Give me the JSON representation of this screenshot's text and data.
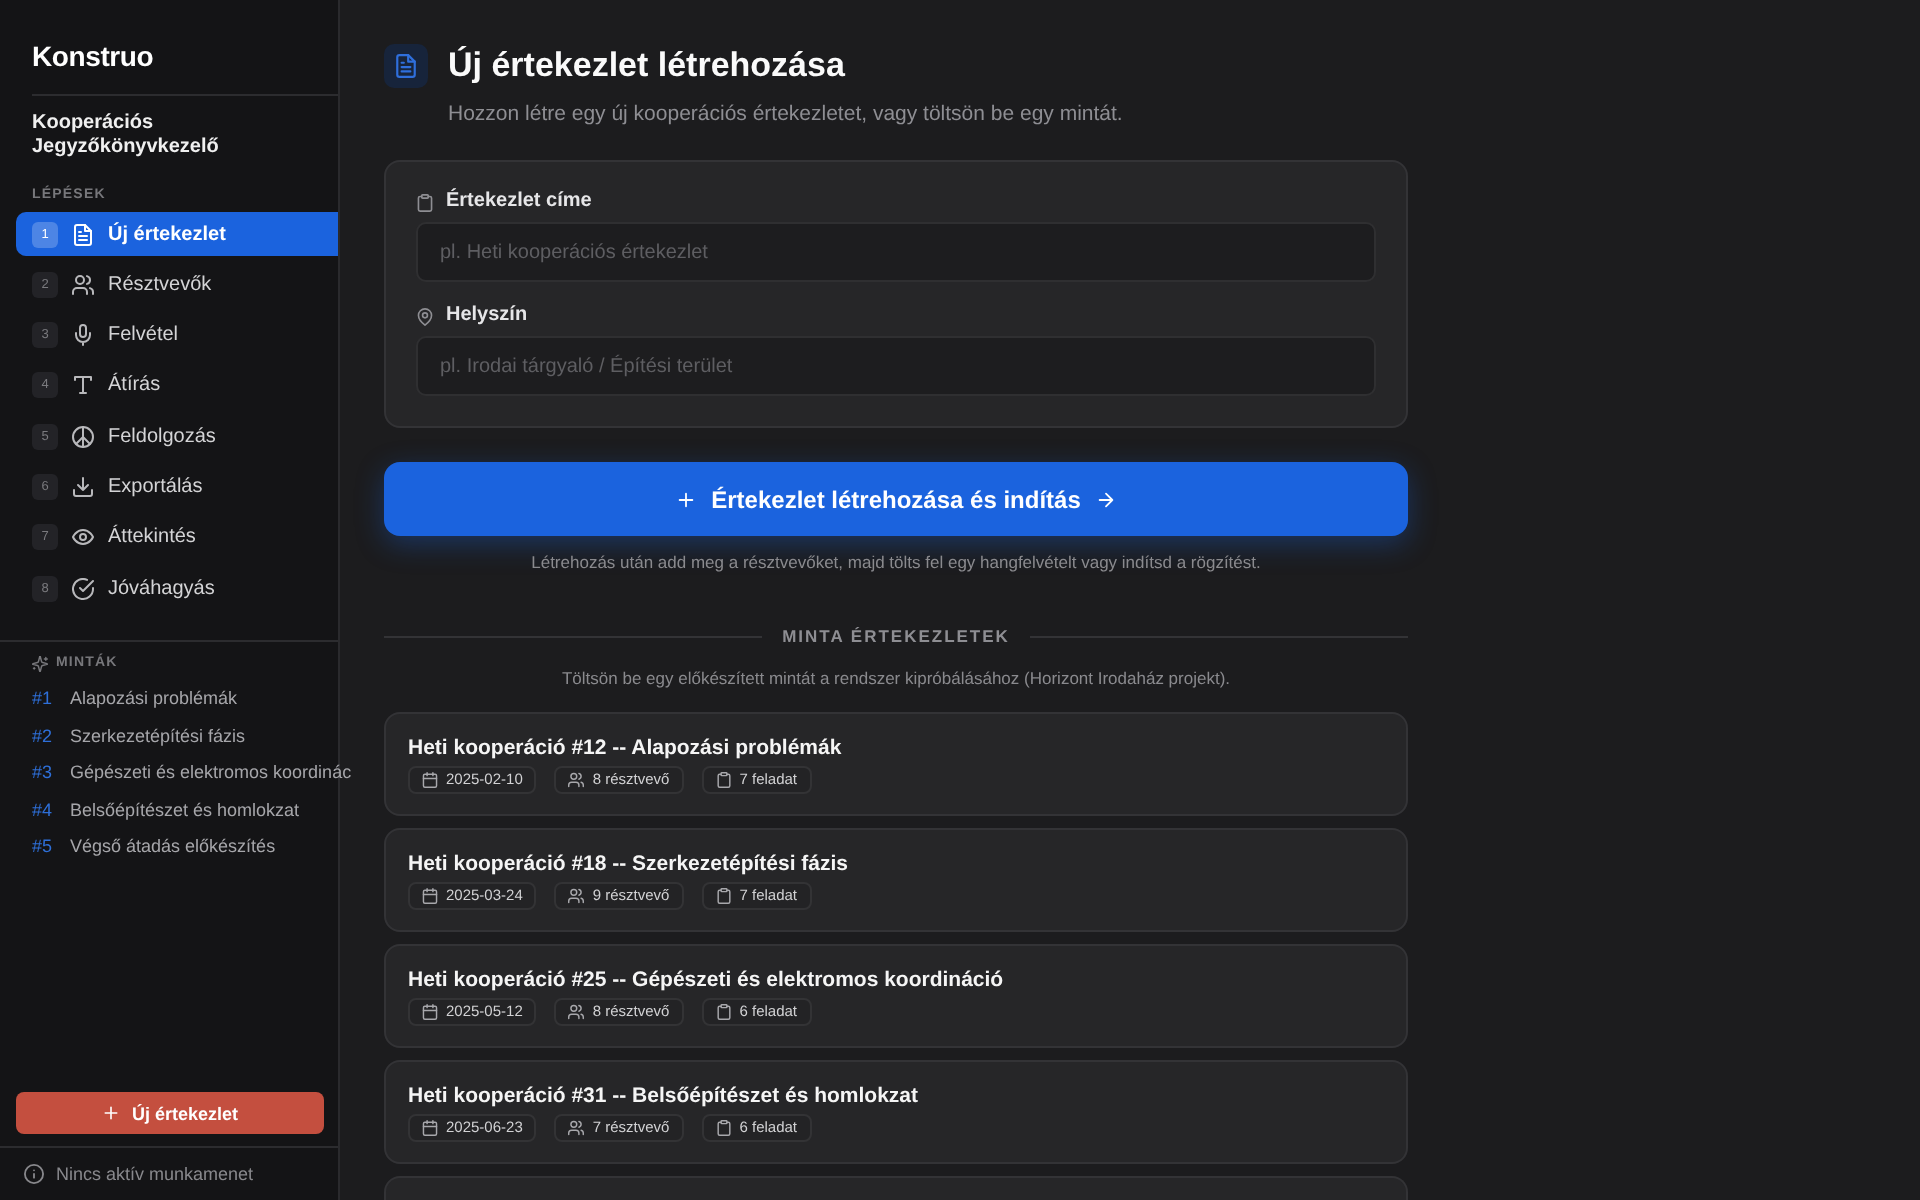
{
  "sidebar": {
    "brand": "Konstruo",
    "subtitle": "Kooperációs Jegyzőkönyvkezelő",
    "steps_heading": "LÉPÉSEK",
    "steps": [
      {
        "number": "1",
        "label": "Új értekezlet",
        "selected": true
      },
      {
        "number": "2",
        "label": "Résztvevők",
        "selected": false
      },
      {
        "number": "3",
        "label": "Felvétel",
        "selected": false
      },
      {
        "number": "4",
        "label": "Átírás",
        "selected": false
      },
      {
        "number": "5",
        "label": "Feldolgozás",
        "selected": false
      },
      {
        "number": "6",
        "label": "Exportálás",
        "selected": false
      },
      {
        "number": "7",
        "label": "Áttekintés",
        "selected": false
      },
      {
        "number": "8",
        "label": "Jóváhagyás",
        "selected": false
      }
    ],
    "samples_heading": "MINTÁK",
    "samples": [
      {
        "number": "#1",
        "label": "Alapozási problémák"
      },
      {
        "number": "#2",
        "label": "Szerkezetépítési fázis"
      },
      {
        "number": "#3",
        "label": "Gépészeti és elektromos koordinác"
      },
      {
        "number": "#4",
        "label": "Belsőépítészet és homlokzat"
      },
      {
        "number": "#5",
        "label": "Végső átadás előkészítés"
      }
    ],
    "new_button": "Új értekezlet",
    "status": "Nincs aktív munkamenet"
  },
  "header": {
    "title": "Új értekezlet létrehozása",
    "subtitle": "Hozzon létre egy új kooperációs értekezletet, vagy töltsön be egy mintát."
  },
  "form": {
    "fields": [
      {
        "label": "Értekezlet címe",
        "placeholder": "pl. Heti kooperációs értekezlet"
      },
      {
        "label": "Helyszín",
        "placeholder": "pl. Irodai tárgyaló / Építési terület"
      }
    ]
  },
  "primary_button": "Értekezlet létrehozása és indítás",
  "hint": "Létrehozás után add meg a résztvevőket, majd tölts fel egy hangfelvételt vagy indítsd a rögzítést.",
  "samples_section": {
    "heading": "MINTA ÉRTEKEZLETEK",
    "description": "Töltsön be egy előkészített mintát a rendszer kipróbálásához (Horizont Irodaház projekt).",
    "cards": [
      {
        "title": "Heti kooperáció #12 -- Alapozási problémák",
        "date": "2025-02-10",
        "participants": "8 résztvevő",
        "tasks": "7 feladat"
      },
      {
        "title": "Heti kooperáció #18 -- Szerkezetépítési fázis",
        "date": "2025-03-24",
        "participants": "9 résztvevő",
        "tasks": "7 feladat"
      },
      {
        "title": "Heti kooperáció #25 -- Gépészeti és elektromos koordináció",
        "date": "2025-05-12",
        "participants": "8 résztvevő",
        "tasks": "6 feladat"
      },
      {
        "title": "Heti kooperáció #31 -- Belsőépítészet és homlokzat",
        "date": "2025-06-23",
        "participants": "7 résztvevő",
        "tasks": "6 feladat"
      }
    ],
    "partial_card": true
  }
}
